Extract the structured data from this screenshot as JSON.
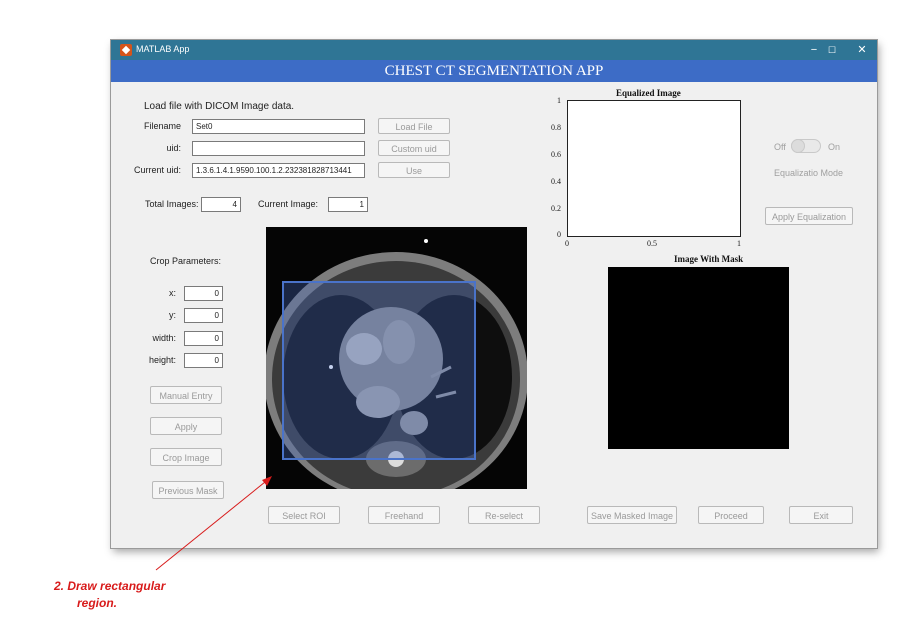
{
  "window": {
    "title": "MATLAB App",
    "controls": {
      "minimize": "−",
      "maximize": "☐",
      "close": "✕"
    },
    "banner": "CHEST CT SEGMENTATION APP"
  },
  "load": {
    "heading": "Load file with DICOM Image data.",
    "filename_label": "Filename",
    "filename_value": "Set0",
    "uid_label": "uid:",
    "uid_value": "",
    "current_uid_label": "Current uid:",
    "current_uid_value": "1.3.6.1.4.1.9590.100.1.2.232381828713441",
    "load_file_button": "Load File",
    "custom_uid_button": "Custom uid",
    "use_button": "Use",
    "total_images_label": "Total Images:",
    "total_images_value": "4",
    "current_image_label": "Current Image:",
    "current_image_value": "1"
  },
  "crop": {
    "heading": "Crop Parameters:",
    "x_label": "x:",
    "x_value": "0",
    "y_label": "y:",
    "y_value": "0",
    "width_label": "width:",
    "width_value": "0",
    "height_label": "height:",
    "height_value": "0",
    "manual_entry_button": "Manual Entry",
    "apply_button": "Apply",
    "crop_image_button": "Crop Image",
    "previous_mask_button": "Previous Mask"
  },
  "equalized_plot": {
    "title": "Equalized Image",
    "y_ticks": [
      "1",
      "0.8",
      "0.6",
      "0.4",
      "0.2",
      "0"
    ],
    "x_ticks": [
      "0",
      "0.5",
      "1"
    ]
  },
  "mask_plot": {
    "title": "Image With Mask"
  },
  "equalization": {
    "toggle_off": "Off",
    "toggle_on": "On",
    "mode_label": "Equalizatio Mode",
    "apply_button": "Apply Equalization"
  },
  "bottom_buttons": {
    "select_roi": "Select ROI",
    "freehand": "Freehand",
    "reselect": "Re-select",
    "save_masked": "Save Masked Image",
    "proceed": "Proceed",
    "exit": "Exit"
  },
  "annotation": {
    "line1": "2.   Draw rectangular",
    "line2": "region.",
    "color": "#d81b1b"
  },
  "colors": {
    "titlebar": "#2f7595",
    "banner": "#3d6cc6",
    "roi": "#4a73c9"
  }
}
